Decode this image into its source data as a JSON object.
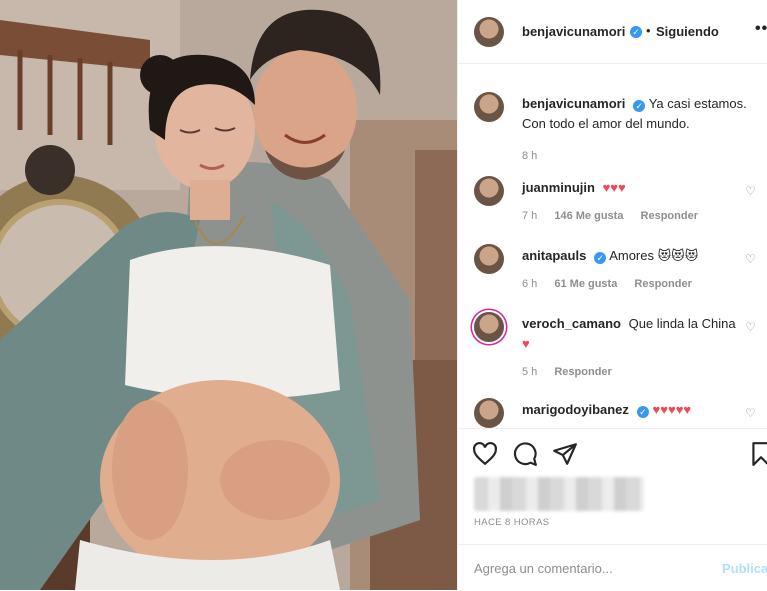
{
  "header": {
    "username": "benjavicunamori",
    "verified_mark": "✓",
    "follow_separator": "•",
    "follow_status": "Siguiendo",
    "more_icon": "•••"
  },
  "caption": {
    "username": "benjavicunamori",
    "text": "Ya casi estamos. Con todo el amor del mundo.",
    "time": "8 h"
  },
  "comments": [
    {
      "username": "juanminujin",
      "verified": false,
      "text": "♥♥♥",
      "time": "7 h",
      "likes": "146 Me gusta",
      "reply": "Responder"
    },
    {
      "username": "anitapauls",
      "verified": true,
      "text": "Amores 😻😻😻",
      "time": "6 h",
      "likes": "61 Me gusta",
      "reply": "Responder"
    },
    {
      "username": "veroch_camano",
      "verified": false,
      "text": "Que linda la China",
      "heart": "♥",
      "time": "5 h",
      "reply": "Responder"
    },
    {
      "username": "marigodoyibanez",
      "verified": true,
      "text": "♥♥♥♥♥"
    }
  ],
  "actions": {
    "icons": [
      "heart-icon",
      "comment-icon",
      "share-icon",
      "bookmark-icon"
    ],
    "posted_ago": "HACE 8 HORAS"
  },
  "add_comment": {
    "placeholder": "Agrega un comentario...",
    "publish": "Publicar"
  },
  "colors": {
    "verified": "#3897f0",
    "heart": "#ed4956",
    "muted": "#8e8e8e",
    "publish_disabled": "#b2dffc"
  }
}
